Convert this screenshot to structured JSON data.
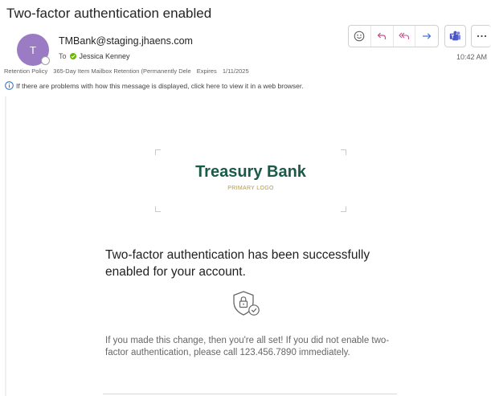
{
  "message": {
    "subject": "Two-factor authentication enabled",
    "sender_initial": "T",
    "sender_email": "TMBank@staging.jhaens.com",
    "to_label": "To",
    "recipient": "Jessica Kenney",
    "time": "10:42 AM",
    "retention_label": "Retention Policy",
    "retention_value": "365-Day Item Mailbox Retention (Permanently Dele",
    "expires_label": "Expires",
    "expires_value": "1/11/2025",
    "info_text": "If there are problems with how this message is displayed, click here to view it in a web browser."
  },
  "toolbar": {
    "buttons": [
      "emoji-react",
      "reply",
      "reply-all",
      "forward",
      "teams",
      "more"
    ]
  },
  "email_body": {
    "brand_name": "Treasury Bank",
    "brand_subtitle": "PRIMARY LOGO",
    "headline": "Two-factor authentication has been successfully enabled for your account.",
    "body": "If you made this change, then you're all set! If you did not enable two-factor authentication, please call 123.456.7890 immediately."
  },
  "colors": {
    "avatar": "#9b7cc4",
    "presence": "#6bb700",
    "action_icons": "#c44f8a",
    "forward_icon": "#3b6fd6",
    "teams_icon": "#4b53bc",
    "brand": "#1a5a48",
    "brand_subtitle": "#b8983c"
  }
}
